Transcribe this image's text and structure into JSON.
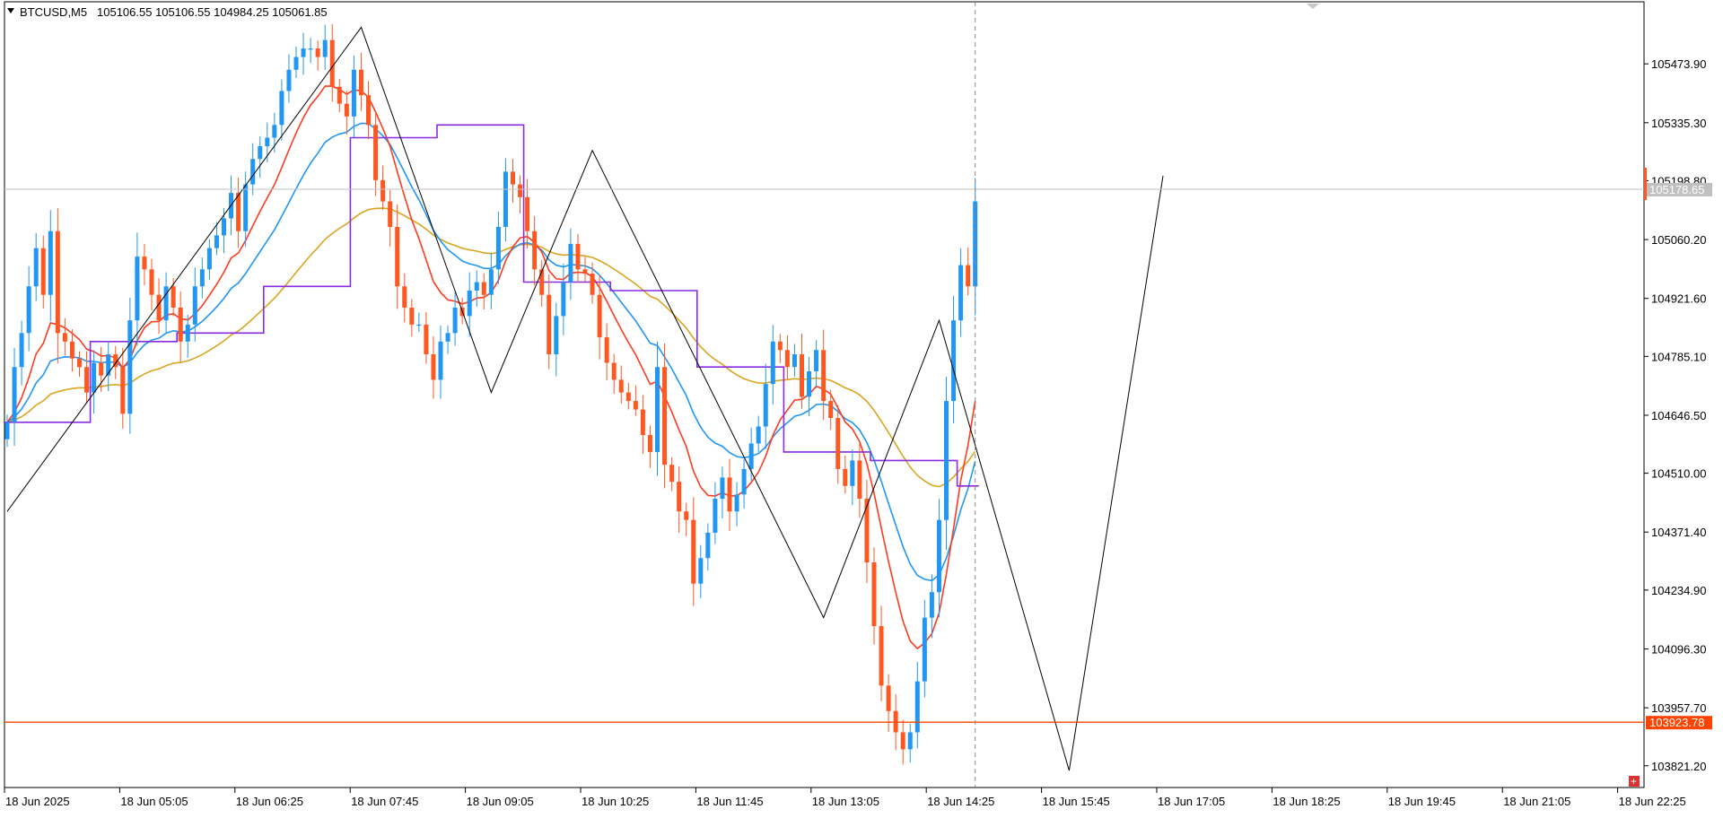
{
  "header": {
    "symbol": "BTCUSD,M5",
    "ohlc": "105106.55 105106.55 104984.25 105061.85"
  },
  "colors": {
    "bull": "#2196f3",
    "bear": "#ff5722",
    "ma_red": "#ff3b1f",
    "ma_blue": "#2196f3",
    "ma_gold": "#daa520",
    "step": "#8a2be2",
    "zigzag": "#000000",
    "hline": "#ff4400",
    "bid": "#c0c0c0"
  },
  "bid_line": {
    "price": "105178.65"
  },
  "support_line": {
    "price": "103923.78"
  },
  "close_icon": "plus-icon",
  "chart_data": {
    "type": "candlestick",
    "title": "",
    "ylim": [
      103770,
      105620
    ],
    "y_ticks": [
      "105473.90",
      "105335.30",
      "105198.80",
      "105060.20",
      "104921.60",
      "104785.10",
      "104646.50",
      "104510.00",
      "104371.40",
      "104234.90",
      "104096.30",
      "103957.70",
      "103821.20"
    ],
    "x_ticks": [
      "18 Jun 2025",
      "18 Jun 05:05",
      "18 Jun 06:25",
      "18 Jun 07:45",
      "18 Jun 09:05",
      "18 Jun 10:25",
      "18 Jun 11:45",
      "18 Jun 13:05",
      "18 Jun 14:25",
      "18 Jun 15:45",
      "18 Jun 17:05",
      "18 Jun 18:25",
      "18 Jun 19:45",
      "18 Jun 21:05",
      "18 Jun 22:25"
    ],
    "candle_interval_min": 5,
    "closes": [
      104630,
      104760,
      104840,
      104950,
      105040,
      104930,
      105080,
      104840,
      104820,
      104780,
      104760,
      104700,
      104770,
      104740,
      104790,
      104760,
      104650,
      104870,
      105020,
      104990,
      104930,
      104870,
      104950,
      104900,
      104820,
      104860,
      104950,
      104990,
      105040,
      105070,
      105110,
      105170,
      105080,
      105190,
      105250,
      105280,
      105300,
      105330,
      105410,
      105460,
      105490,
      105510,
      105510,
      105490,
      105530,
      105420,
      105380,
      105350,
      105460,
      105400,
      105330,
      105200,
      105150,
      105090,
      104950,
      104900,
      104860,
      104860,
      104790,
      104730,
      104820,
      104840,
      104900,
      104880,
      104940,
      104960,
      104930,
      104990,
      105090,
      105220,
      105190,
      105160,
      105080,
      104990,
      104930,
      104790,
      104880,
      104960,
      105050,
      104990,
      104980,
      104930,
      104830,
      104770,
      104730,
      104700,
      104680,
      104660,
      104600,
      104560,
      104760,
      104530,
      104490,
      104420,
      104400,
      104250,
      104310,
      104370,
      104450,
      104500,
      104420,
      104460,
      104520,
      104580,
      104620,
      104720,
      104820,
      104800,
      104760,
      104790,
      104690,
      104750,
      104800,
      104680,
      104640,
      104520,
      104480,
      104540,
      104450,
      104300,
      104150,
      104010,
      103950,
      103900,
      103860,
      103900,
      104020,
      104170,
      104230,
      104400,
      104680,
      104870,
      105000,
      104950,
      105150
    ],
    "zigzag": [
      {
        "time": "18 Jun 03:45",
        "price": 104420
      },
      {
        "time": "18 Jun 07:50",
        "price": 105560
      },
      {
        "time": "18 Jun 09:20",
        "price": 104700
      },
      {
        "time": "18 Jun 10:30",
        "price": 105270
      },
      {
        "time": "18 Jun 13:10",
        "price": 104170
      },
      {
        "time": "18 Jun 14:30",
        "price": 104870
      },
      {
        "time": "18 Jun 16:00",
        "price": 103810
      },
      {
        "time": "18 Jun 17:05",
        "price": 105210
      }
    ]
  }
}
